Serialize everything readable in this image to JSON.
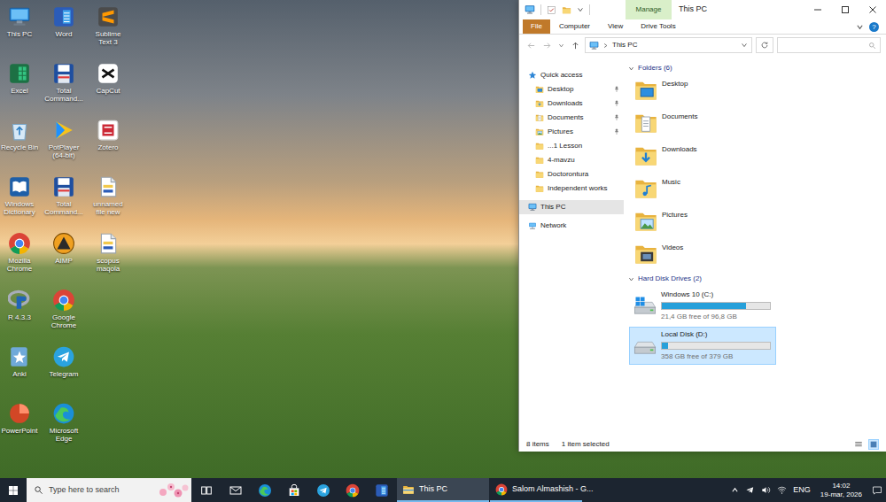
{
  "desktop": {
    "icons": [
      {
        "label": "This PC",
        "kind": "pc"
      },
      {
        "label": "Excel",
        "kind": "excel"
      },
      {
        "label": "Recycle Bin",
        "kind": "recycle"
      },
      {
        "label": "Windows Dictionary",
        "kind": "dictionary"
      },
      {
        "label": "Mozilla Chrome",
        "kind": "chrome"
      },
      {
        "label": "R 4.3.3",
        "kind": "r"
      },
      {
        "label": "Anki",
        "kind": "anki"
      },
      {
        "label": "PowerPoint",
        "kind": "powerpoint"
      },
      {
        "label": "Word",
        "kind": "word"
      },
      {
        "label": "Total Command...",
        "kind": "totalcmd"
      },
      {
        "label": "PotPlayer (64-bit)",
        "kind": "potplayer"
      },
      {
        "label": "Total Command...",
        "kind": "totalcmd"
      },
      {
        "label": "AIMP",
        "kind": "aimp"
      },
      {
        "label": "Google Chrome",
        "kind": "chrome"
      },
      {
        "label": "Telegram",
        "kind": "telegram"
      },
      {
        "label": "Microsoft Edge",
        "kind": "edge"
      },
      {
        "label": "Sublime Text 3",
        "kind": "sublime"
      },
      {
        "label": "CapCut",
        "kind": "capcut"
      },
      {
        "label": "Zotero",
        "kind": "zotero"
      },
      {
        "label": "unnamed file new",
        "kind": "file"
      },
      {
        "label": "scopus maqola",
        "kind": "file"
      }
    ]
  },
  "explorer": {
    "title": "This PC",
    "contextual_tab": "Manage",
    "ribbon_tabs": [
      {
        "label": "File",
        "kind": "file",
        "selected": false
      },
      {
        "label": "Computer",
        "kind": "tab",
        "selected": false
      },
      {
        "label": "View",
        "kind": "tab",
        "selected": false
      },
      {
        "label": "Drive Tools",
        "kind": "tab",
        "selected": false
      }
    ],
    "help": "?",
    "address": {
      "path": "This PC"
    },
    "nav": [
      {
        "label": "Quick access",
        "kind": "star",
        "pinned": false,
        "selected": false
      },
      {
        "label": "Desktop",
        "kind": "desktop",
        "pinned": true,
        "selected": false
      },
      {
        "label": "Downloads",
        "kind": "downloads",
        "pinned": true,
        "selected": false
      },
      {
        "label": "Documents",
        "kind": "documents",
        "pinned": true,
        "selected": false
      },
      {
        "label": "Pictures",
        "kind": "pictures",
        "pinned": true,
        "selected": false
      },
      {
        "label": "...1 Lesson",
        "kind": "folder",
        "pinned": false,
        "selected": false
      },
      {
        "label": "4-mavzu",
        "kind": "folder",
        "pinned": false,
        "selected": false
      },
      {
        "label": "Doctorontura",
        "kind": "folder",
        "pinned": false,
        "selected": false
      },
      {
        "label": "Independent works",
        "kind": "folder",
        "pinned": false,
        "selected": false
      },
      {
        "label": "This PC",
        "kind": "pc",
        "pinned": false,
        "selected": true
      },
      {
        "label": "Network",
        "kind": "network",
        "pinned": false,
        "selected": false
      }
    ],
    "folders": {
      "title": "Folders (6)",
      "expanded": true,
      "items": [
        {
          "label": "Desktop",
          "kind": "desktop"
        },
        {
          "label": "Documents",
          "kind": "documents"
        },
        {
          "label": "Downloads",
          "kind": "downloads"
        },
        {
          "label": "Music",
          "kind": "music"
        },
        {
          "label": "Pictures",
          "kind": "pictures"
        },
        {
          "label": "Videos",
          "kind": "videos"
        }
      ]
    },
    "drives": {
      "title": "Hard Disk Drives (2)",
      "expanded": true,
      "items": [
        {
          "label": "Windows 10 (C:)",
          "kind": "system",
          "level": 0.78,
          "free": "21,4 GB free of 96,8 GB",
          "selected": false
        },
        {
          "label": "Local Disk (D:)",
          "kind": "local",
          "level": 0.055,
          "free": "358 GB free of 379 GB",
          "selected": true
        }
      ]
    },
    "status_bar": {
      "items": "8 items",
      "selection": "1 item selected"
    }
  },
  "taskbar": {
    "search_placeholder": "Type here to search",
    "pinned": [
      {
        "kind": "taskview"
      },
      {
        "kind": "mail"
      },
      {
        "kind": "edge"
      },
      {
        "kind": "store"
      },
      {
        "kind": "telegram"
      },
      {
        "kind": "chrome"
      },
      {
        "kind": "word"
      }
    ],
    "windows": [
      {
        "label": "This PC",
        "kind": "explorer",
        "selected": true
      },
      {
        "label": "Salom Almashish - G...",
        "kind": "chrome",
        "selected": false
      }
    ],
    "tray": {
      "language": "ENG",
      "time": "14:02",
      "date": "19-mar, 2026"
    }
  }
}
